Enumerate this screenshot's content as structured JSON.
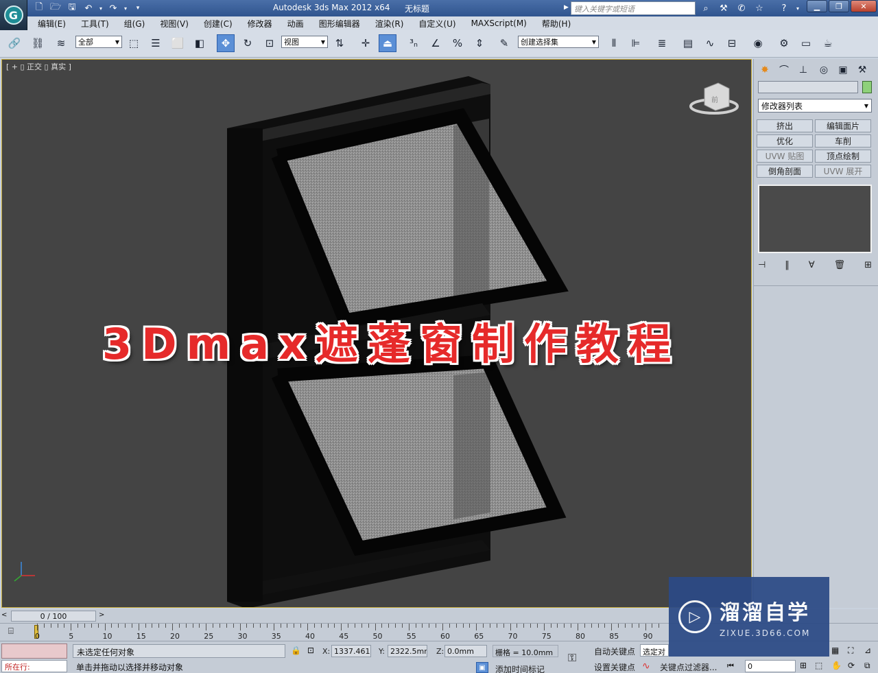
{
  "app": {
    "title": "Autodesk 3ds Max  2012 x64",
    "document": "无标题",
    "search_placeholder": "键入关键字或短语"
  },
  "menus": [
    "编辑(E)",
    "工具(T)",
    "组(G)",
    "视图(V)",
    "创建(C)",
    "修改器",
    "动画",
    "图形编辑器",
    "渲染(R)",
    "自定义(U)",
    "MAXScript(M)",
    "帮助(H)"
  ],
  "toolbar": {
    "selection_filter": "全部",
    "reference_coord": "视图",
    "named_selection": "创建选择集"
  },
  "viewport": {
    "label": "[ + ▯ 正交 ▯ 真实 ]",
    "overlay_title": "3Dmax遮蓬窗制作教程",
    "viewcube_face": "前"
  },
  "command_panel": {
    "modifier_list": "修改器列表",
    "buttons": [
      "挤出",
      "编辑面片",
      "优化",
      "车削",
      "UVW 贴图",
      "顶点绘制",
      "倒角剖面",
      "UVW 展开"
    ]
  },
  "timeline": {
    "frame_display": "0 / 100",
    "ticks": [
      "0",
      "5",
      "10",
      "15",
      "20",
      "25",
      "30",
      "35",
      "40",
      "45",
      "50",
      "55",
      "60",
      "65",
      "70",
      "75",
      "80",
      "85",
      "90"
    ]
  },
  "status": {
    "selection": "未选定任何对象",
    "prompt": "单击并拖动以选择并移动对象",
    "running_label": "所在行:",
    "x_label": "X:",
    "x_value": "1337.461m",
    "y_label": "Y:",
    "y_value": "2322.5mm",
    "z_label": "Z:",
    "z_value": "0.0mm",
    "grid": "栅格 = 10.0mm",
    "auto_key": "自动关键点",
    "selected_object": "选定对",
    "set_key": "设置关键点",
    "key_filters": "关键点过滤器...",
    "add_time_tag": "添加时间标记",
    "current_frame": "0"
  },
  "watermark": {
    "name": "溜溜自学",
    "url": "ZIXUE.3D66.COM"
  },
  "colors": {
    "viewport_bg": "#444444",
    "title_red": "#e62a2a",
    "active_tool": "#5b8fd6"
  }
}
